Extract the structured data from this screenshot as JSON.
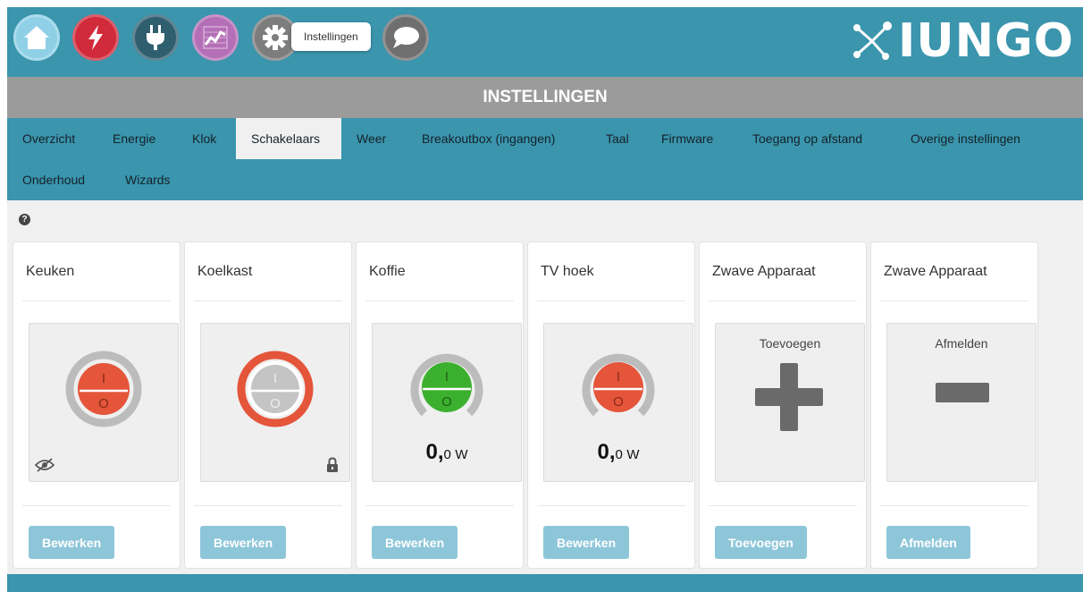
{
  "nav": {
    "tooltip": "Instellingen",
    "logo_text": "IUNGO",
    "colors": {
      "home": "#8fd0e6",
      "energy": "#d12a3a",
      "plug": "#2f5e6f",
      "chart": "#b46fb6",
      "settings": "#7d7d7d",
      "chat": "#6f6f6f"
    }
  },
  "header": {
    "title": "INSTELLINGEN"
  },
  "tabs": [
    {
      "label": "Overzicht"
    },
    {
      "label": "Energie"
    },
    {
      "label": "Klok"
    },
    {
      "label": "Schakelaars",
      "active": true
    },
    {
      "label": "Weer"
    },
    {
      "label": "Breakoutbox (ingangen)"
    },
    {
      "label": "Taal"
    },
    {
      "label": "Firmware"
    },
    {
      "label": "Toegang op afstand"
    },
    {
      "label": "Overige instellingen"
    },
    {
      "label": "Onderhoud"
    },
    {
      "label": "Wizards"
    }
  ],
  "help_icon": "?",
  "cards": [
    {
      "title": "Keuken",
      "switch_state": "off",
      "button": "Bewerken"
    },
    {
      "title": "Koelkast",
      "switch_state": "locked",
      "button": "Bewerken"
    },
    {
      "title": "Koffie",
      "switch_state": "on",
      "power_int": "0,",
      "power_dec": "0",
      "power_unit": "W",
      "button": "Bewerken"
    },
    {
      "title": "TV hoek",
      "switch_state": "off",
      "power_int": "0,",
      "power_dec": "0",
      "power_unit": "W",
      "button": "Bewerken"
    },
    {
      "title": "Zwave Apparaat",
      "action_label": "Toevoegen",
      "button": "Toevoegen"
    },
    {
      "title": "Zwave Apparaat",
      "action_label": "Afmelden",
      "button": "Afmelden"
    }
  ],
  "switch_marks": {
    "on": "I",
    "off": "O"
  },
  "colors": {
    "accent": "#3a95ad",
    "switch_off": "#e4553a",
    "switch_on": "#3bb02e",
    "button": "#8ec6d9"
  }
}
